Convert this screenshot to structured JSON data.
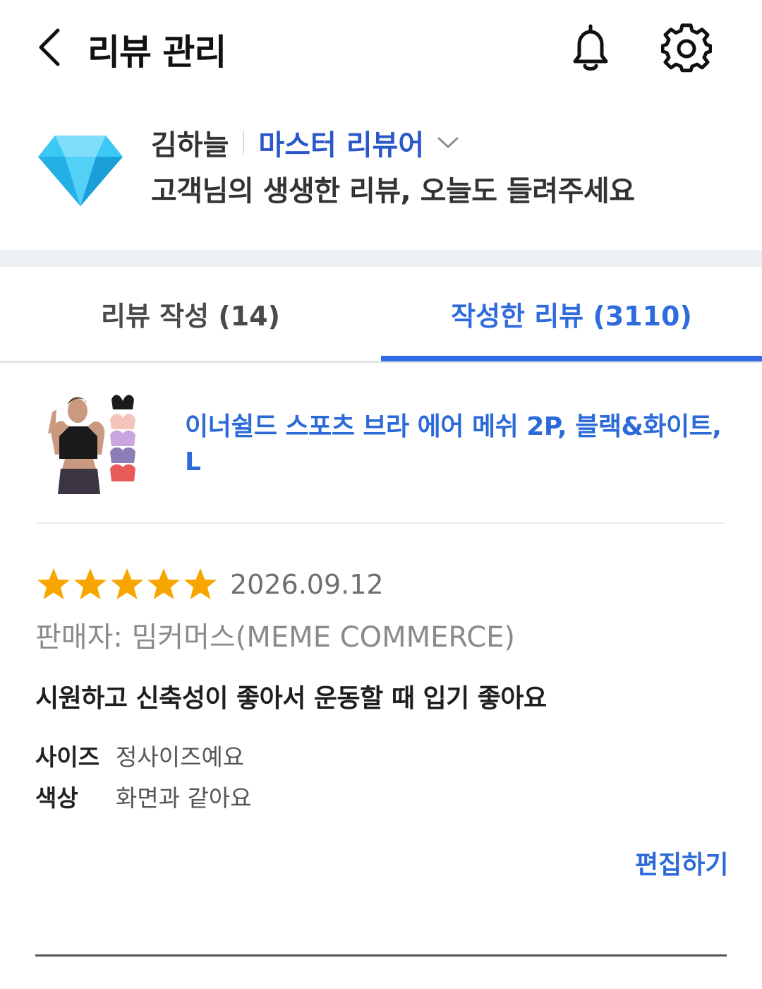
{
  "header": {
    "title": "리뷰 관리",
    "icons": {
      "back": "chevron-left-icon",
      "notifications": "bell-icon",
      "settings": "gear-icon"
    }
  },
  "profile": {
    "badge_icon": "diamond-icon",
    "name": "김하늘",
    "grade": "마스터 리뷰어",
    "tagline": "고객님의 생생한 리뷰, 오늘도 들려주세요"
  },
  "tabs": [
    {
      "label": "리뷰 작성 (14)",
      "active": false
    },
    {
      "label": "작성한 리뷰 (3110)",
      "active": true
    }
  ],
  "product": {
    "name": "이너쉴드 스포츠 브라 에어 메쉬 2P, 블랙&화이트, L"
  },
  "review": {
    "rating": 5,
    "rating_max": 5,
    "date": "2026.09.12",
    "seller": "판매자: 밈커머스(MEME COMMERCE)",
    "body": "시원하고 신축성이 좋아서 운동할 때 입기 좋아요",
    "attributes": [
      {
        "key": "사이즈",
        "value": "정사이즈예요"
      },
      {
        "key": "색상",
        "value": "화면과 같아요"
      }
    ],
    "edit_label": "편집하기"
  },
  "colors": {
    "accent": "#2f6ce6",
    "link": "#2b6ad8",
    "grade": "#2b57c8",
    "star": "#f7a600",
    "diamond": "#33c4f2"
  }
}
